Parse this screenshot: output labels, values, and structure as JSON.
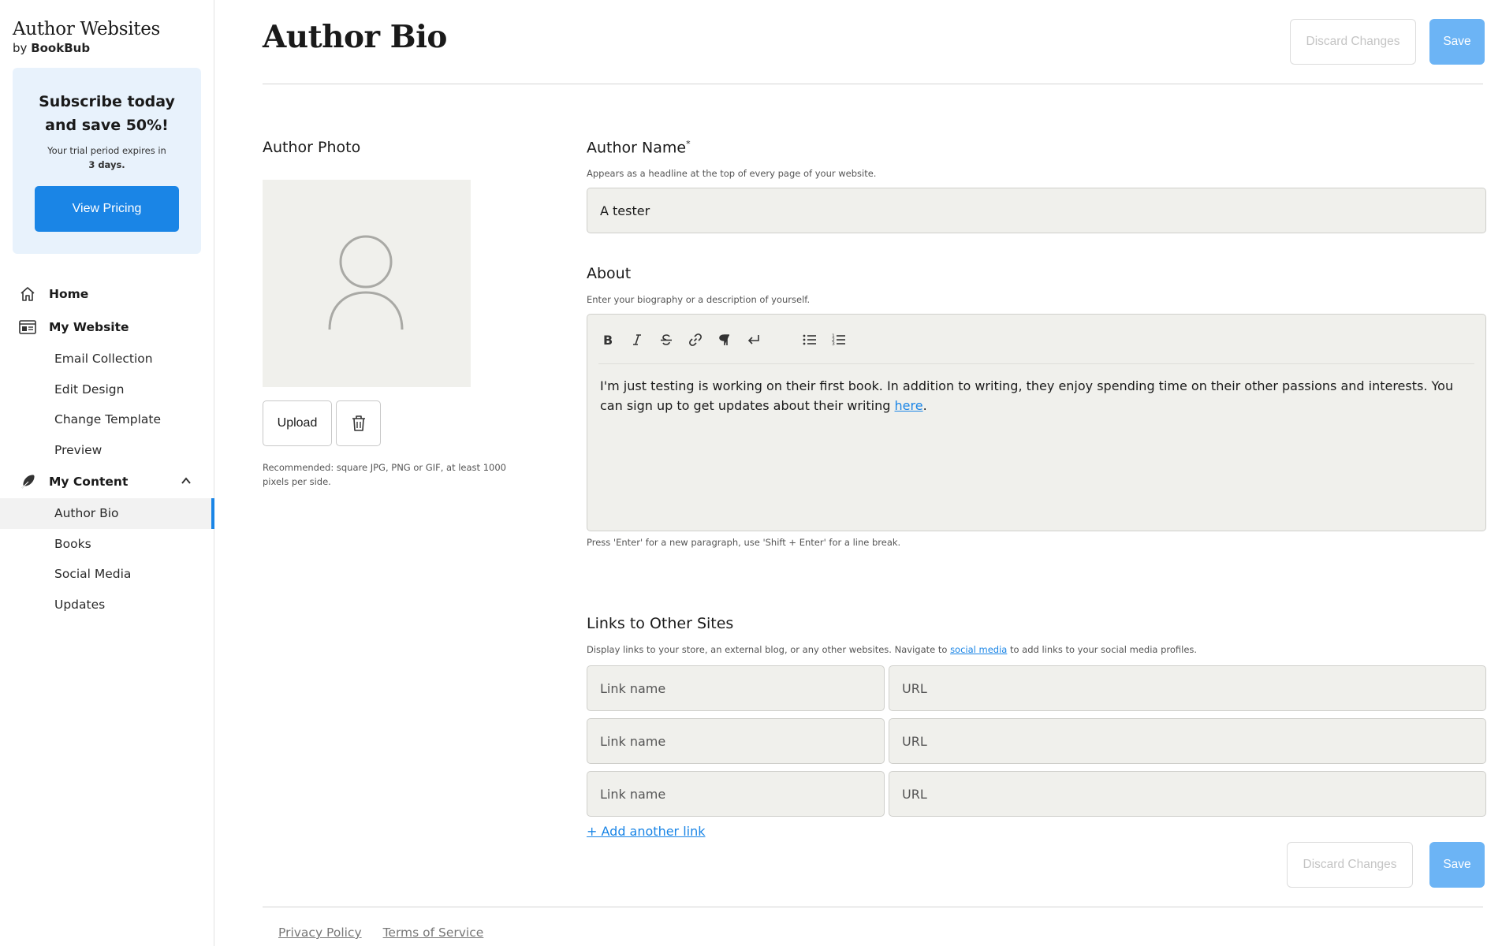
{
  "brand": {
    "title": "Author Websites",
    "by": "by",
    "company": "BookBub"
  },
  "promo": {
    "title_line1": "Subscribe today",
    "title_line2": "and save 50%!",
    "trial_text": "Your trial period expires in",
    "trial_days": "3 days.",
    "button_label": "View Pricing"
  },
  "nav": {
    "home": "Home",
    "my_website": "My Website",
    "website_items": [
      "Email Collection",
      "Edit Design",
      "Change Template",
      "Preview"
    ],
    "my_content": "My Content",
    "content_items": [
      "Author Bio",
      "Books",
      "Social Media",
      "Updates"
    ],
    "active_item": "Author Bio"
  },
  "header": {
    "title": "Author Bio",
    "discard_label": "Discard Changes",
    "save_label": "Save"
  },
  "photo": {
    "label": "Author Photo",
    "upload_label": "Upload",
    "help": "Recommended: square JPG, PNG or GIF, at least 1000 pixels per side."
  },
  "author_name": {
    "label": "Author Name",
    "required_mark": "*",
    "help": "Appears as a headline at the top of every page of your website.",
    "value": "A tester"
  },
  "about": {
    "label": "About",
    "help": "Enter your biography or a description of yourself.",
    "text_before_link": "I'm just testing is working on their first book. In addition to writing, they enjoy spending time on their other passions and interests. You can sign up to get updates about their writing ",
    "link_text": "here",
    "text_after_link": ".",
    "footer_help": "Press 'Enter' for a new paragraph, use 'Shift + Enter' for a line break.",
    "toolbar_icons": [
      "bold-icon",
      "italic-icon",
      "strikethrough-icon",
      "link-icon",
      "paragraph-icon",
      "line-break-icon",
      "bullet-list-icon",
      "numbered-list-icon"
    ]
  },
  "links": {
    "label": "Links to Other Sites",
    "help_before": "Display links to your store, an external blog, or any other websites. Navigate to ",
    "help_link": "social media",
    "help_after": " to add links to your social media profiles.",
    "rows": [
      {
        "name_placeholder": "Link name",
        "url_placeholder": "URL"
      },
      {
        "name_placeholder": "Link name",
        "url_placeholder": "URL"
      },
      {
        "name_placeholder": "Link name",
        "url_placeholder": "URL"
      }
    ],
    "add_label": "+ Add another link"
  },
  "footer": {
    "privacy": "Privacy Policy",
    "terms": "Terms of Service"
  },
  "colors": {
    "accent": "#1a85e6",
    "save_button": "#6cb4f5",
    "promo_bg": "#e8f2fc",
    "input_bg": "#f0f0ec"
  }
}
